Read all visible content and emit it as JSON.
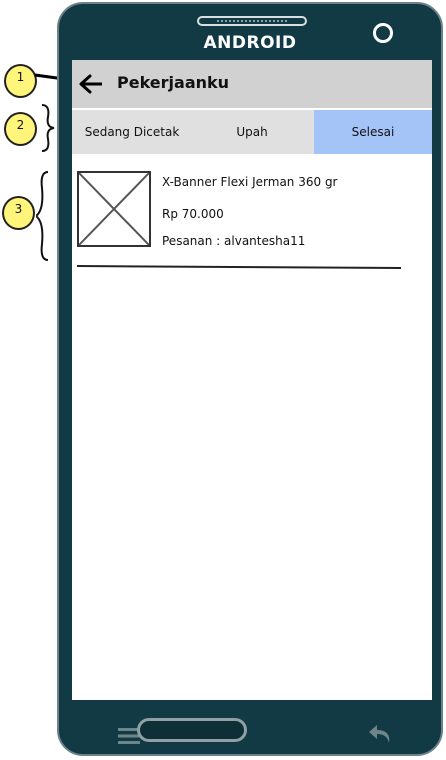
{
  "device": {
    "brand_label": "ANDROID"
  },
  "app_bar": {
    "title": "Pekerjaanku",
    "back_icon": "arrow-left-icon"
  },
  "tabs": [
    {
      "label": "Sedang Dicetak",
      "active": false
    },
    {
      "label": "Upah",
      "active": false
    },
    {
      "label": "Selesai",
      "active": true
    }
  ],
  "job": {
    "name": "X-Banner Flexi Jerman 360 gr",
    "price": "Rp 70.000",
    "customer": "Pesanan : alvantesha11",
    "image_icon": "image-placeholder-icon"
  },
  "nav_bar": {
    "menu_icon": "menu-icon",
    "home_icon": "home-button",
    "back_icon": "return-icon"
  },
  "annotations": {
    "c1": "1",
    "c2": "2",
    "c3": "3"
  },
  "colors": {
    "frame": "#123a44",
    "appbar": "#d1d1d1",
    "tabs": "#e0e0e0",
    "active_tab": "#a4c3f7",
    "callout": "#fff57a"
  }
}
